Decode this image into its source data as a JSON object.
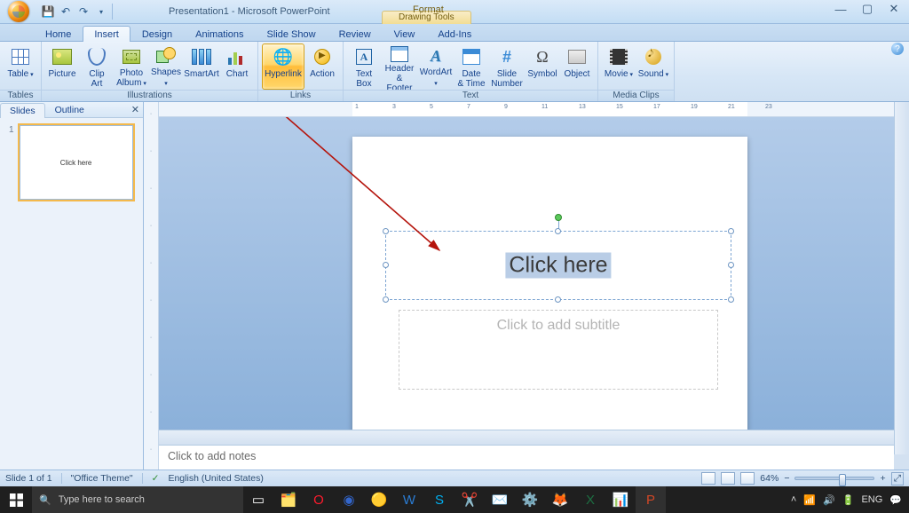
{
  "titlebar": {
    "doc_title": "Presentation1 - Microsoft PowerPoint",
    "context_title": "Drawing Tools"
  },
  "tabs": [
    "Home",
    "Insert",
    "Design",
    "Animations",
    "Slide Show",
    "Review",
    "View",
    "Add-Ins"
  ],
  "context_tab": "Format",
  "active_tab_index": 1,
  "ribbon": {
    "groups": [
      {
        "label": "Tables",
        "items": [
          {
            "name": "table",
            "label": "Table",
            "dropdown": true
          }
        ]
      },
      {
        "label": "Illustrations",
        "items": [
          {
            "name": "picture",
            "label": "Picture"
          },
          {
            "name": "clip-art",
            "label": "Clip\nArt"
          },
          {
            "name": "photo-album",
            "label": "Photo\nAlbum",
            "dropdown": true
          },
          {
            "name": "shapes",
            "label": "Shapes",
            "dropdown": true
          },
          {
            "name": "smartart",
            "label": "SmartArt"
          },
          {
            "name": "chart",
            "label": "Chart"
          }
        ]
      },
      {
        "label": "Links",
        "items": [
          {
            "name": "hyperlink",
            "label": "Hyperlink",
            "highlight": true
          },
          {
            "name": "action",
            "label": "Action"
          }
        ]
      },
      {
        "label": "Text",
        "items": [
          {
            "name": "text-box",
            "label": "Text\nBox"
          },
          {
            "name": "header-footer",
            "label": "Header\n& Footer"
          },
          {
            "name": "wordart",
            "label": "WordArt",
            "dropdown": true
          },
          {
            "name": "date-time",
            "label": "Date\n& Time"
          },
          {
            "name": "slide-number",
            "label": "Slide\nNumber"
          },
          {
            "name": "symbol",
            "label": "Symbol"
          },
          {
            "name": "object",
            "label": "Object"
          }
        ]
      },
      {
        "label": "Media Clips",
        "items": [
          {
            "name": "movie",
            "label": "Movie",
            "dropdown": true
          },
          {
            "name": "sound",
            "label": "Sound",
            "dropdown": true
          }
        ]
      }
    ]
  },
  "left_pane": {
    "tabs": [
      "Slides",
      "Outline"
    ],
    "active": 0,
    "thumb_text": "Click here"
  },
  "slide": {
    "title_text": "Click here",
    "subtitle_placeholder": "Click to add subtitle"
  },
  "notes_placeholder": "Click to add notes",
  "status": {
    "slide_info": "Slide 1 of 1",
    "theme": "\"Office Theme\"",
    "language": "English (United States)",
    "zoom": "64%"
  },
  "taskbar": {
    "search_placeholder": "Type here to search",
    "tray_lang": "ENG"
  }
}
